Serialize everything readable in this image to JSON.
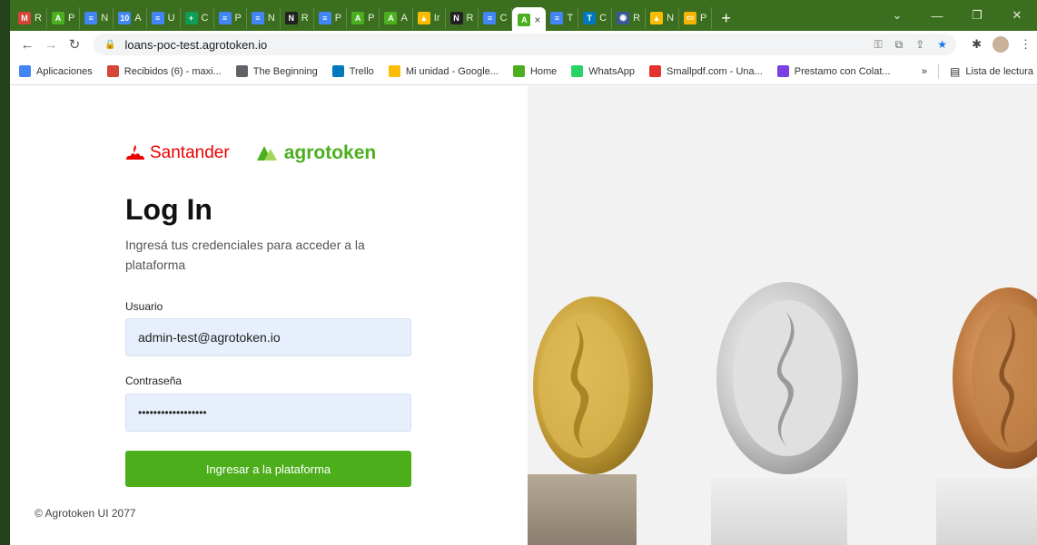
{
  "browser": {
    "tabs": [
      {
        "fav": "M",
        "color": "#d44638",
        "label": "R"
      },
      {
        "fav": "A",
        "color": "#4caf1f",
        "label": "P"
      },
      {
        "fav": "≡",
        "color": "#4285f4",
        "label": "N"
      },
      {
        "fav": "10",
        "color": "#4285f4",
        "label": "A"
      },
      {
        "fav": "≡",
        "color": "#4285f4",
        "label": "U"
      },
      {
        "fav": "+",
        "color": "#0f9d58",
        "label": "C"
      },
      {
        "fav": "≡",
        "color": "#4285f4",
        "label": "P"
      },
      {
        "fav": "≡",
        "color": "#4285f4",
        "label": "N"
      },
      {
        "fav": "N",
        "color": "#222222",
        "label": "R"
      },
      {
        "fav": "≡",
        "color": "#4285f4",
        "label": "P"
      },
      {
        "fav": "A",
        "color": "#4caf1f",
        "label": "P"
      },
      {
        "fav": "A",
        "color": "#4caf1f",
        "label": "A"
      },
      {
        "fav": "▲",
        "color": "#fbbc04",
        "label": "Ir"
      },
      {
        "fav": "N",
        "color": "#222222",
        "label": "R"
      },
      {
        "fav": "≡",
        "color": "#4285f4",
        "label": "C"
      }
    ],
    "active_tab": {
      "fav": "A",
      "color": "#4caf1f",
      "close": "×"
    },
    "tabs_after": [
      {
        "fav": "≡",
        "color": "#4285f4",
        "label": "T"
      },
      {
        "fav": "T",
        "color": "#0079bf",
        "label": "C"
      },
      {
        "fav": "◉",
        "color": "#3b5998",
        "label": "R"
      },
      {
        "fav": "▲",
        "color": "#fbbc04",
        "label": "N"
      },
      {
        "fav": "▭",
        "color": "#f4b400",
        "label": "P"
      }
    ],
    "new_tab": "+",
    "url": "loans-poc-test.agrotoken.io",
    "bookmarks": [
      {
        "label": "Aplicaciones",
        "color": "#4285f4"
      },
      {
        "label": "Recibidos (6) - maxi...",
        "color": "#d44638"
      },
      {
        "label": "The Beginning",
        "color": "#5f6368"
      },
      {
        "label": "Trello",
        "color": "#0079bf"
      },
      {
        "label": "Mi unidad - Google...",
        "color": "#fbbc04"
      },
      {
        "label": "Home",
        "color": "#4caf1f"
      },
      {
        "label": "WhatsApp",
        "color": "#25d366"
      },
      {
        "label": "Smallpdf.com - Una...",
        "color": "#e5322d"
      },
      {
        "label": "Prestamo con Colat...",
        "color": "#7b3fe4"
      }
    ],
    "overflow": "»",
    "reading_list": "Lista de lectura"
  },
  "login": {
    "brand_santander": "Santander",
    "brand_agrotoken": "agrotoken",
    "title": "Log In",
    "subtitle": "Ingresá tus credenciales para acceder a la plataforma",
    "user_label": "Usuario",
    "user_value": "admin-test@agrotoken.io",
    "password_label": "Contraseña",
    "password_value": "••••••••••••••••••",
    "submit_label": "Ingresar a la plataforma",
    "copyright": "© Agrotoken UI 2077"
  },
  "colors": {
    "accent": "#4dae1c",
    "brand_santander": "#ec0000",
    "brand_agrotoken": "#4caf1f"
  }
}
